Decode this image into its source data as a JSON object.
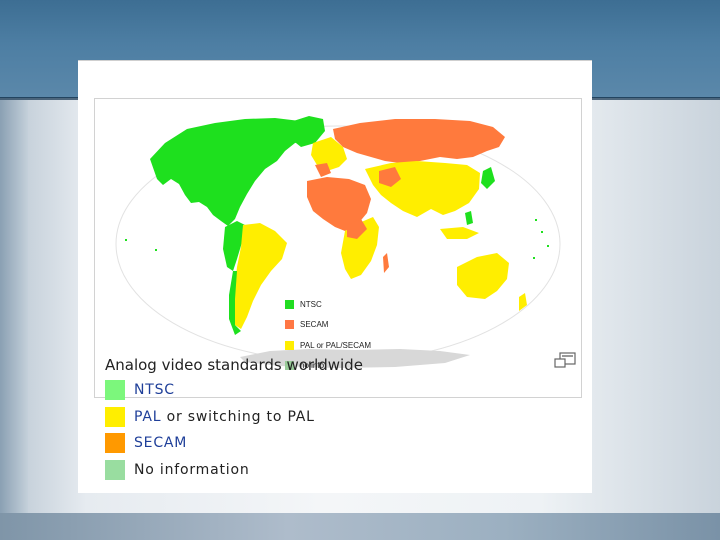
{
  "caption": {
    "title": "Analog video standards worldwide",
    "legend": [
      {
        "link": "NTSC",
        "rest": "",
        "color": "#7cf77c"
      },
      {
        "link": "PAL",
        "rest": " or switching to PAL",
        "color": "#ffee00"
      },
      {
        "link": "SECAM",
        "rest": "",
        "color": "#ff9900"
      },
      {
        "link": "",
        "rest": "No information",
        "color": "#99dda0"
      }
    ]
  },
  "map": {
    "legend": [
      {
        "label": "NTSC",
        "color": "#22dd22"
      },
      {
        "label": "SECAM",
        "color": "#ff7744"
      },
      {
        "label": "PAL or PAL/SECAM",
        "color": "#ffee00"
      },
      {
        "label": "no info",
        "color": "#99cc99"
      }
    ],
    "colors": {
      "ntsc": "#1ee01e",
      "secam": "#ff7a3d",
      "pal": "#ffee00",
      "ocean": "#ffffff",
      "antarctica": "#d8d8d8"
    }
  },
  "icons": {
    "enlarge": "enlarge-icon"
  }
}
